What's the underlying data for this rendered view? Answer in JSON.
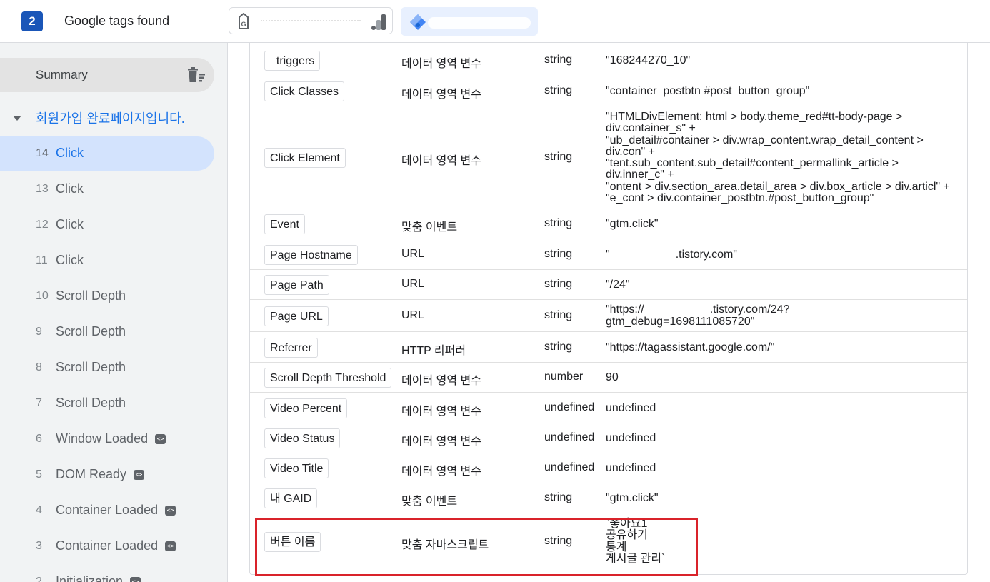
{
  "header": {
    "tag_count": "2",
    "title": "Google tags found",
    "ga_tag_icon": "google-tag-icon",
    "analytics_icon": "analytics-bars-icon",
    "gtm_icon": "gtm-diamond-icon"
  },
  "sidebar": {
    "summary_label": "Summary",
    "page_label": "회원가입 완료페이지입니다.",
    "events": [
      {
        "num": "14",
        "name": "Click",
        "active": true,
        "code": false
      },
      {
        "num": "13",
        "name": "Click",
        "active": false,
        "code": false
      },
      {
        "num": "12",
        "name": "Click",
        "active": false,
        "code": false
      },
      {
        "num": "11",
        "name": "Click",
        "active": false,
        "code": false
      },
      {
        "num": "10",
        "name": "Scroll Depth",
        "active": false,
        "code": false
      },
      {
        "num": "9",
        "name": "Scroll Depth",
        "active": false,
        "code": false
      },
      {
        "num": "8",
        "name": "Scroll Depth",
        "active": false,
        "code": false
      },
      {
        "num": "7",
        "name": "Scroll Depth",
        "active": false,
        "code": false
      },
      {
        "num": "6",
        "name": "Window Loaded",
        "active": false,
        "code": true
      },
      {
        "num": "5",
        "name": "DOM Ready",
        "active": false,
        "code": true
      },
      {
        "num": "4",
        "name": "Container Loaded",
        "active": false,
        "code": true
      },
      {
        "num": "3",
        "name": "Container Loaded",
        "active": false,
        "code": true
      },
      {
        "num": "2",
        "name": "Initialization",
        "active": false,
        "code": true
      }
    ],
    "code_icon_glyph": "<>"
  },
  "variables": [
    {
      "name": "_triggers",
      "type": "데이터 영역 변수",
      "return": "string",
      "value": [
        "\"168244270_10\""
      ]
    },
    {
      "name": "Click Classes",
      "type": "데이터 영역 변수",
      "return": "string",
      "value": [
        "\"container_postbtn #post_button_group\""
      ]
    },
    {
      "name": "Click Element",
      "type": "데이터 영역 변수",
      "return": "string",
      "value": [
        "\"HTMLDivElement: html > body.theme_red#tt-body-page >",
        "div.container_s\" +",
        "\"ub_detail#container > div.wrap_content.wrap_detail_content >",
        "div.con\" +",
        "\"tent.sub_content.sub_detail#content_permallink_article >",
        "div.inner_c\" +",
        "\"ontent > div.section_area.detail_area > div.box_article > div.articl\" +",
        "\"e_cont > div.container_postbtn.#post_button_group\""
      ]
    },
    {
      "name": "Event",
      "type": "맞춤 이벤트",
      "return": "string",
      "value": [
        "\"gtm.click\""
      ]
    },
    {
      "name": "Page Hostname",
      "type": "URL",
      "return": "string",
      "value": [
        "\"",
        ".tistory.com\""
      ]
    },
    {
      "name": "Page Path",
      "type": "URL",
      "return": "string",
      "value": [
        "\"/24\""
      ]
    },
    {
      "name": "Page URL",
      "type": "URL",
      "return": "string",
      "value": [
        "\"https://",
        ".tistory.com/24?",
        "gtm_debug=1698111085720\""
      ]
    },
    {
      "name": "Referrer",
      "type": "HTTP 리퍼러",
      "return": "string",
      "value": [
        "\"https://tagassistant.google.com/\""
      ]
    },
    {
      "name": "Scroll Depth Threshold",
      "type": "데이터 영역 변수",
      "return": "number",
      "value": [
        "90"
      ]
    },
    {
      "name": "Video Percent",
      "type": "데이터 영역 변수",
      "return": "undefined",
      "value": [
        "undefined"
      ]
    },
    {
      "name": "Video Status",
      "type": "데이터 영역 변수",
      "return": "undefined",
      "value": [
        "undefined"
      ]
    },
    {
      "name": "Video Title",
      "type": "데이터 영역 변수",
      "return": "undefined",
      "value": [
        "undefined"
      ]
    },
    {
      "name": "내 GAID",
      "type": "맞춤 이벤트",
      "return": "string",
      "value": [
        "\"gtm.click\""
      ]
    },
    {
      "name": "버튼 이름",
      "type": "맞춤 자바스크립트",
      "return": "string",
      "value": [
        "`좋아요1",
        "공유하기",
        "통계",
        "게시글 관리`"
      ]
    }
  ],
  "colors": {
    "accent": "#1a73e8",
    "badge": "#1a56b8",
    "active_row": "#d3e3fd",
    "highlight_box": "#d9232a"
  }
}
